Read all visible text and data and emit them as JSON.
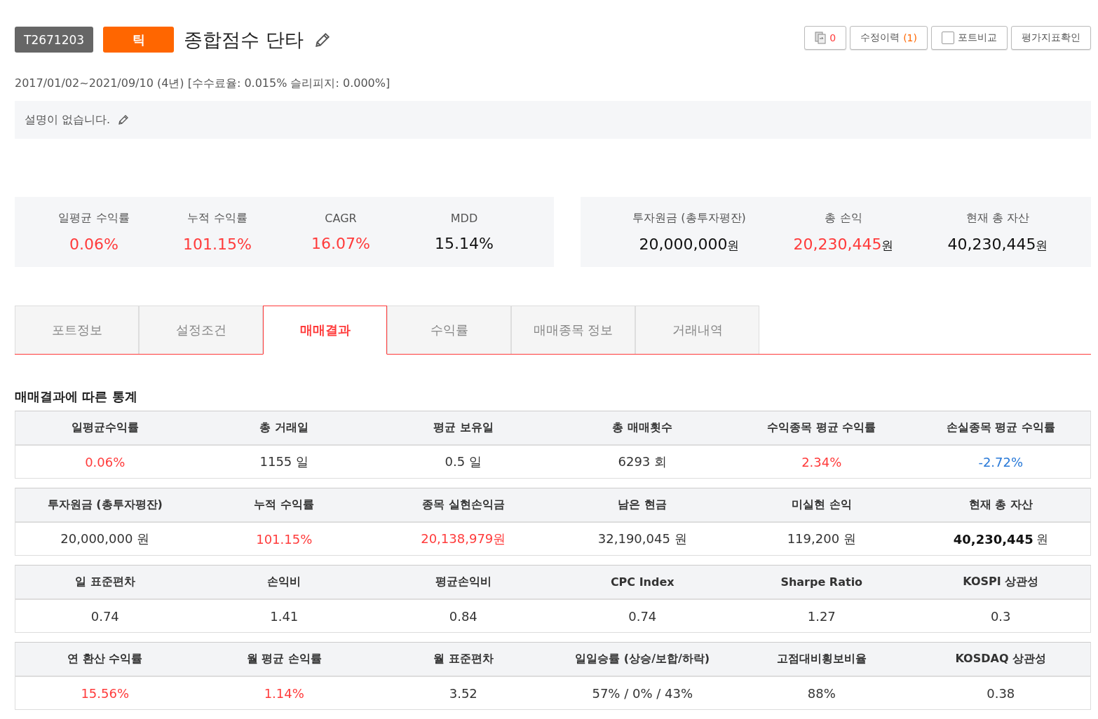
{
  "header": {
    "code": "T2671203",
    "type_badge": "틱",
    "title": "종합점수 단타"
  },
  "buttons": [
    {
      "kind": "copy",
      "count": "0"
    },
    {
      "kind": "history",
      "label": "수정이력",
      "count": "(1)"
    },
    {
      "kind": "checkbox",
      "label": "포트비교",
      "checked": false
    },
    {
      "kind": "plain",
      "label": "평가지표확인"
    }
  ],
  "period": "2017/01/02~2021/09/10 (4년) [수수료율: 0.015% 슬리피지: 0.000%]",
  "description": "설명이 없습니다.",
  "summary_left": [
    {
      "label": "일평균 수익률",
      "value": "0.06%",
      "color": "#ff3b3b"
    },
    {
      "label": "누적 수익률",
      "value": "101.15%",
      "color": "#ff3b3b"
    },
    {
      "label": "CAGR",
      "value": "16.07%",
      "color": "#ff3b3b"
    },
    {
      "label": "MDD",
      "value": "15.14%",
      "color": "#111111"
    }
  ],
  "summary_right": [
    {
      "label": "투자원금 (총투자평잔)",
      "value": "20,000,000",
      "unit": "원",
      "color": "#111111"
    },
    {
      "label": "총 손익",
      "value": "20,230,445",
      "unit": "원",
      "color": "#ff3b3b"
    },
    {
      "label": "현재 총 자산",
      "value": "40,230,445",
      "unit": "원",
      "color": "#111111"
    }
  ],
  "tabs": [
    {
      "label": "포트정보",
      "selected": false
    },
    {
      "label": "설정조건",
      "selected": false
    },
    {
      "label": "매매결과",
      "selected": true
    },
    {
      "label": "수익률",
      "selected": false
    },
    {
      "label": "매매종목 정보",
      "selected": false
    },
    {
      "label": "거래내역",
      "selected": false
    }
  ],
  "stats_title": "매매결과에 따른 통계",
  "stats_tables": [
    {
      "columns": [
        "일평균수익률",
        "총 거래일",
        "평균 보유일",
        "총 매매횟수",
        "수익종목 평균 수익률",
        "손실종목 평균 수익률"
      ],
      "cells": [
        {
          "value": "0.06%",
          "color": "#ff3b3b"
        },
        {
          "value": "1155 일",
          "color": "#333333"
        },
        {
          "value": "0.5 일",
          "color": "#333333"
        },
        {
          "value": "6293 회",
          "color": "#333333"
        },
        {
          "value": "2.34%",
          "color": "#ff3b3b"
        },
        {
          "value": "-2.72%",
          "color": "#2a7ad8"
        }
      ]
    },
    {
      "columns": [
        "투자원금 (총투자평잔)",
        "누적 수익률",
        "종목 실현손익금",
        "남은 현금",
        "미실현 손익",
        "현재 총 자산"
      ],
      "cells": [
        {
          "value": "20,000,000 원",
          "color": "#333333"
        },
        {
          "value": "101.15%",
          "color": "#ff3b3b"
        },
        {
          "value": "20,138,979원",
          "color": "#ff3b3b"
        },
        {
          "value": "32,190,045 원",
          "color": "#333333"
        },
        {
          "value": "119,200 원",
          "color": "#333333"
        },
        {
          "value": "40,230,445",
          "unit": "원",
          "color": "#111111",
          "bold": true
        }
      ]
    },
    {
      "columns": [
        "일 표준편차",
        "손익비",
        "평균손익비",
        "CPC Index",
        "Sharpe Ratio",
        "KOSPI 상관성"
      ],
      "cells": [
        {
          "value": "0.74",
          "color": "#333333"
        },
        {
          "value": "1.41",
          "color": "#333333"
        },
        {
          "value": "0.84",
          "color": "#333333"
        },
        {
          "value": "0.74",
          "color": "#333333"
        },
        {
          "value": "1.27",
          "color": "#333333"
        },
        {
          "value": "0.3",
          "color": "#333333"
        }
      ]
    },
    {
      "columns": [
        "연 환산 수익률",
        "월 평균 손익률",
        "월 표준편차",
        "일일승률 (상승/보합/하락)",
        "고점대비횡보비율",
        "KOSDAQ 상관성"
      ],
      "cells": [
        {
          "value": "15.56%",
          "color": "#ff3b3b"
        },
        {
          "value": "1.14%",
          "color": "#ff3b3b"
        },
        {
          "value": "3.52",
          "color": "#333333"
        },
        {
          "value": "57% / 0% / 43%",
          "color": "#333333"
        },
        {
          "value": "88%",
          "color": "#333333"
        },
        {
          "value": "0.38",
          "color": "#333333"
        }
      ]
    }
  ]
}
